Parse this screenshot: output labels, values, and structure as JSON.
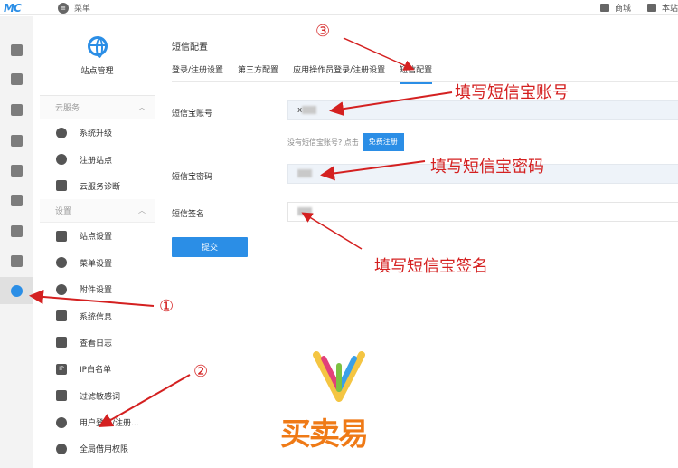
{
  "topbar": {
    "logo": "MC",
    "menu_label": "菜单",
    "right_items": [
      "商城",
      "本站"
    ]
  },
  "rail_icons": [
    "home-icon",
    "apps-icon",
    "cube-icon",
    "modules-icon",
    "gear-cube-icon",
    "users-icon",
    "user-settings-icon",
    "monitor-icon",
    "globe-icon"
  ],
  "sidebar": {
    "site_title": "站点管理",
    "groups": [
      {
        "title": "云服务",
        "items": [
          "系统升级",
          "注册站点",
          "云服务诊断"
        ]
      },
      {
        "title": "设置",
        "items": [
          "站点设置",
          "菜单设置",
          "附件设置",
          "系统信息",
          "查看日志",
          "IP白名单",
          "过滤敏感词",
          "用户登录/注册...",
          "全局借用权限"
        ]
      }
    ],
    "ip_badge": "IP"
  },
  "main": {
    "title": "短信配置",
    "tabs": [
      "登录/注册设置",
      "第三方配置",
      "应用操作员登录/注册设置",
      "短信配置"
    ],
    "active_tab": 3,
    "fields": [
      {
        "label": "短信宝账号",
        "value": "x"
      },
      {
        "label": "短信宝密码",
        "value": ""
      },
      {
        "label": "短信签名",
        "value": ""
      }
    ],
    "hint_text": "没有短信宝账号? 点击",
    "register_button": "免费注册",
    "submit_button": "提交"
  },
  "annotations": {
    "account": "填写短信宝账号",
    "password": "填写短信宝密码",
    "signature": "填写短信宝签名",
    "step1": "①",
    "step2": "②",
    "step3": "③"
  },
  "watermark": {
    "text": "买卖易"
  },
  "colors": {
    "accent": "#2b8ee6",
    "annotation": "#d42020",
    "watermark": "#ef7a16"
  }
}
